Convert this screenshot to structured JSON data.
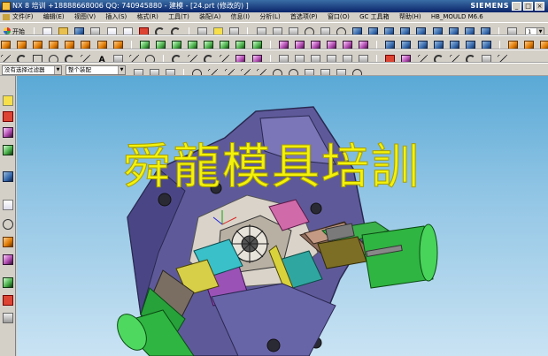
{
  "window": {
    "title": "NX 8 培训 +18888668006 QQ: 740945880 - 建模 - [24.prt (修改的) ]",
    "brand": "SIEMENS",
    "controls": [
      "_",
      "□",
      "×"
    ]
  },
  "menubar": {
    "items": [
      "文件(F)",
      "编辑(E)",
      "视图(V)",
      "插入(S)",
      "格式(R)",
      "工具(T)",
      "装配(A)",
      "信息(I)",
      "分析(L)",
      "首选项(P)",
      "窗口(O)",
      "GC 工具箱",
      "帮助(H)",
      "HB_MOULD M6.6"
    ]
  },
  "toolbar": {
    "start_label": "开始",
    "layer_value": "1"
  },
  "selection_bar": {
    "filter_value": "没有选择过滤器",
    "assembly_value": "整个装配"
  },
  "viewport": {
    "watermark": "舜龍模具培訓",
    "background_top": "#5aa9d6",
    "background_bottom": "#c9e3f3"
  },
  "icons": [
    "nx-logo",
    "start-icon",
    "new-file-icon",
    "open-folder-icon",
    "save-icon",
    "cube-icon",
    "sketch-icon",
    "line-icon",
    "arc-icon",
    "circle-icon",
    "text-icon",
    "snap-icon",
    "history-icon",
    "constraint-navigator-icon",
    "part-navigator-icon",
    "reuse-library-icon",
    "roles-icon"
  ]
}
